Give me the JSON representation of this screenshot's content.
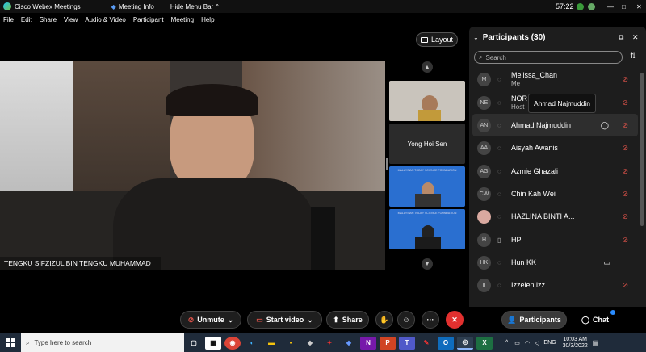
{
  "titlebar": {
    "app": "Cisco Webex Meetings",
    "meeting_info": "Meeting Info",
    "hide_menu": "Hide Menu Bar",
    "chevron": "^",
    "timer": "57:22",
    "min": "—",
    "max": "□",
    "close": "✕"
  },
  "menu": [
    "File",
    "Edit",
    "Share",
    "View",
    "Audio & Video",
    "Participant",
    "Meeting",
    "Help"
  ],
  "layout_label": "Layout",
  "speaker_name": "TENGKU SIFZIZUL BIN TENGKU MUHAMMAD",
  "thumbs": {
    "yong": "Yong Hoi Sen",
    "banner": "MALAYSIAN TODAY SCIENCE FOUNDATION"
  },
  "participants": {
    "title": "Participants (30)",
    "search_placeholder": "Search",
    "tooltip": "Ahmad Najmuddin",
    "rows": [
      {
        "initials": "M",
        "name": "Melissa_Chan",
        "sub": "Me"
      },
      {
        "initials": "NE",
        "name": "NOR A",
        "sub": "Host"
      },
      {
        "initials": "AN",
        "name": "Ahmad Najmuddin",
        "sub": ""
      },
      {
        "initials": "AA",
        "name": "Aisyah Awanis",
        "sub": ""
      },
      {
        "initials": "AG",
        "name": "Azmie Ghazali",
        "sub": ""
      },
      {
        "initials": "CW",
        "name": "Chin Kah Wei",
        "sub": ""
      },
      {
        "initials": "",
        "name": "HAZLINA BINTI A...",
        "sub": ""
      },
      {
        "initials": "H",
        "name": "HP",
        "sub": ""
      },
      {
        "initials": "HK",
        "name": "Hun KK",
        "sub": ""
      },
      {
        "initials": "II",
        "name": "Izzelen izz",
        "sub": ""
      }
    ]
  },
  "controls": {
    "unmute": "Unmute",
    "start_video": "Start video",
    "share": "Share",
    "more": "···",
    "participants": "Participants",
    "chat": "Chat"
  },
  "taskbar": {
    "search": "Type here to search",
    "lang": "ENG",
    "time": "10:03 AM",
    "date": "30/3/2022",
    "icons": [
      "W",
      "O",
      "X",
      "T",
      "P",
      "N"
    ]
  }
}
